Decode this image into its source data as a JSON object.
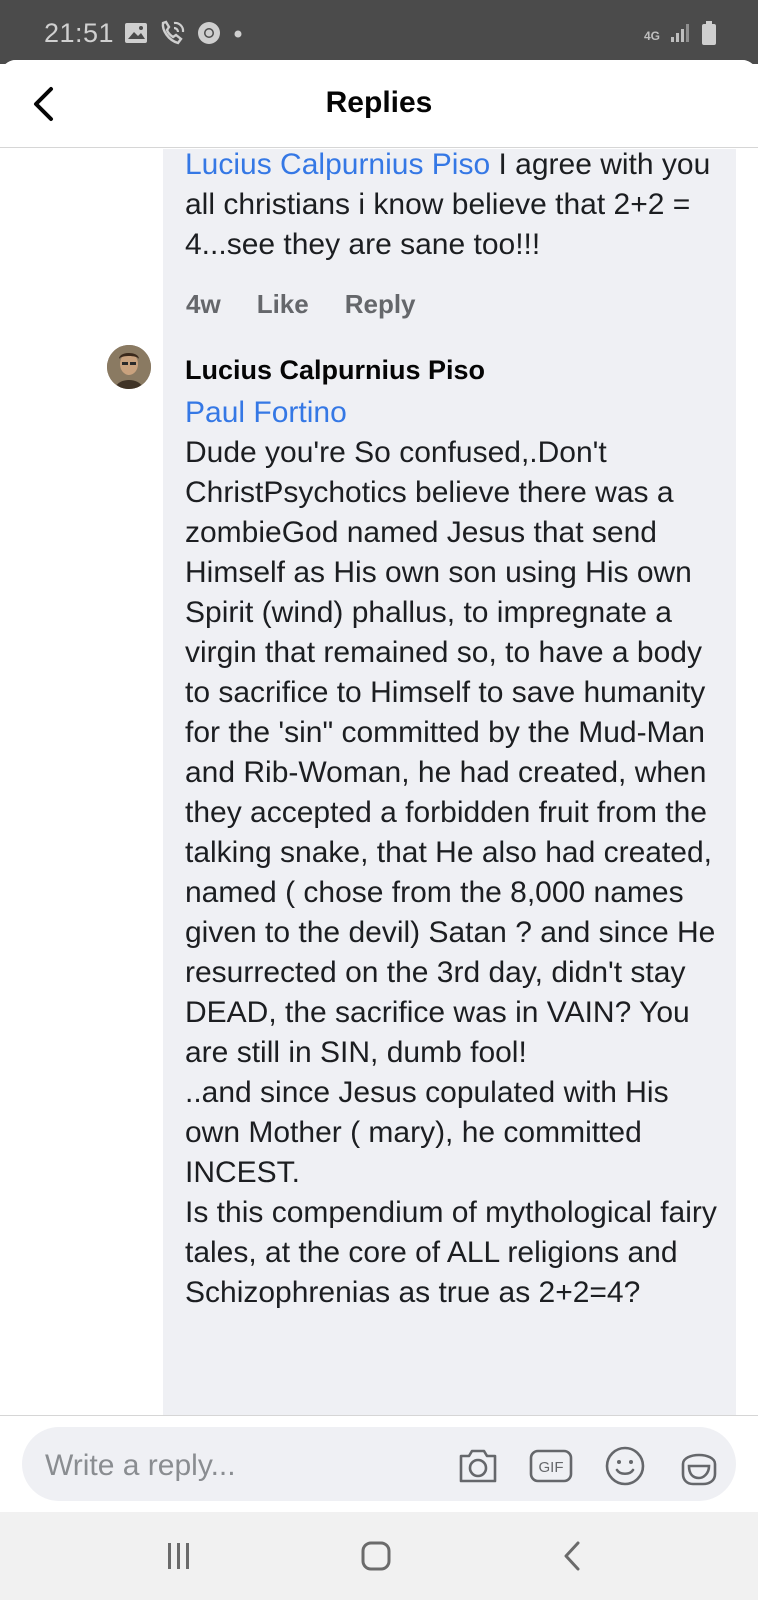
{
  "status_bar": {
    "time": "21:51",
    "network": "4G",
    "left_icons": [
      "image-icon",
      "wifi-call-icon",
      "chrome-icon",
      "dot-icon"
    ],
    "right_icons": [
      "signal-icon",
      "battery-icon"
    ]
  },
  "header": {
    "title": "Replies",
    "back_icon": "back-arrow-icon"
  },
  "previous_comment": {
    "mention": "Lucius Calpurnius Piso",
    "text": " I agree with you all christians i know believe that 2+2 = 4...see they are sane too!!!",
    "time": "4w",
    "like_label": "Like",
    "reply_label": "Reply"
  },
  "reply_comment": {
    "author": "Lucius Calpurnius Piso",
    "mention": "Paul Fortino",
    "text": "Dude you're So confused,.Don't ChristPsychotics believe there was a zombieGod named Jesus that send Himself as His own son using His own Spirit (wind) phallus, to impregnate a virgin that remained so, to have a body to sacrifice to Himself to save humanity for the 'sin\" committed by the Mud-Man and Rib-Woman, he had created, when they accepted a forbidden fruit from the talking snake, that He also had created, named ( chose from the 8,000 names given to the devil) Satan ?  and since He resurrected on the 3rd day, didn't stay DEAD, the sacrifice was in VAIN? You are still in SIN, dumb fool!\n..and since Jesus copulated with His own Mother ( mary), he committed INCEST.\nIs this compendium of mythological fairy tales, at the core of ALL religions and Schizophrenias as true as 2+2=4?"
  },
  "composer": {
    "placeholder": "Write a reply...",
    "icons": [
      "camera-icon",
      "gif-icon",
      "emoji-icon",
      "sticker-icon"
    ]
  },
  "nav_bar": {
    "icons": [
      "recent-apps-icon",
      "home-icon",
      "back-icon"
    ]
  },
  "colors": {
    "mention": "#3578e5",
    "bubble": "#eff0f4",
    "status_bar": "#4b4b4b",
    "meta_text": "#65676b"
  }
}
